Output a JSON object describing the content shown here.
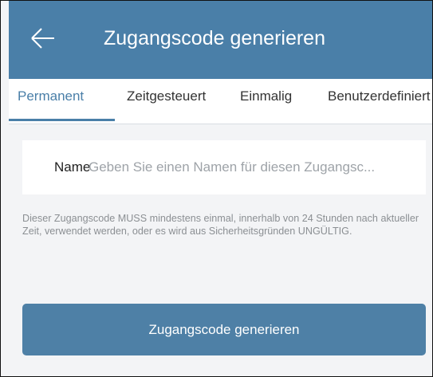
{
  "header": {
    "title": "Zugangscode generieren",
    "back_icon": "arrow-left-icon",
    "background_color": "#4a7fa8"
  },
  "tabs": [
    {
      "label": "Permanent",
      "active": true
    },
    {
      "label": "Zeitgesteuert",
      "active": false
    },
    {
      "label": "Einmalig",
      "active": false
    },
    {
      "label": "Benutzerdefiniert",
      "active": false
    }
  ],
  "form": {
    "name_label": "Name",
    "name_placeholder": "Geben Sie einen Namen für diesen Zugangsc...",
    "name_value": ""
  },
  "info_text": "Dieser Zugangscode MUSS mindestens einmal, innerhalb von 24 Stunden nach aktueller Zeit, verwendet werden, oder es wird aus Sicherheitsgründen UNGÜLTIG.",
  "primary_button": {
    "label": "Zugangscode generieren",
    "color": "#4e80a6"
  },
  "colors": {
    "accent": "#4a7fa8",
    "background": "#f3f4f6",
    "muted_text": "#8b8f93"
  }
}
